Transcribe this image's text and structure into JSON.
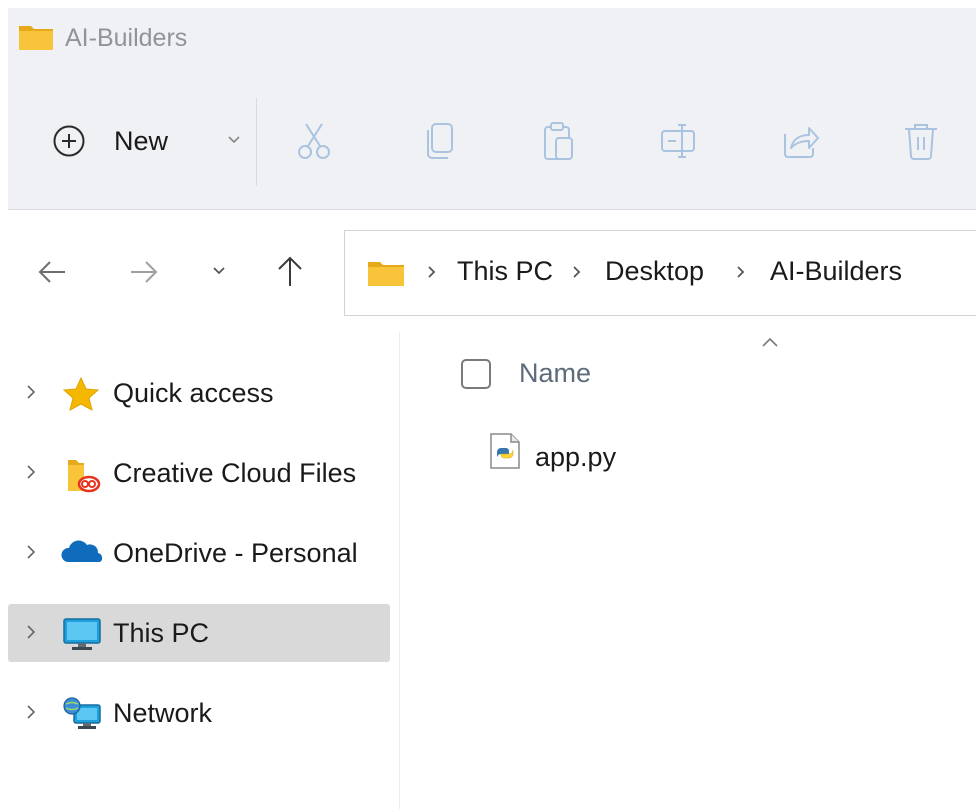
{
  "window": {
    "title": "AI-Builders"
  },
  "toolbar": {
    "new_label": "New",
    "icons": [
      "cut-icon",
      "copy-icon",
      "paste-icon",
      "rename-icon",
      "share-icon",
      "delete-icon"
    ]
  },
  "address": {
    "crumbs": [
      "This PC",
      "Desktop",
      "AI-Builders"
    ]
  },
  "nav": {
    "items": [
      {
        "label": "Quick access",
        "icon": "star-icon"
      },
      {
        "label": "Creative Cloud Files",
        "icon": "creative-cloud-folder-icon"
      },
      {
        "label": "OneDrive - Personal",
        "icon": "onedrive-cloud-icon"
      },
      {
        "label": "This PC",
        "icon": "monitor-icon",
        "selected": true
      },
      {
        "label": "Network",
        "icon": "network-icon"
      }
    ]
  },
  "content": {
    "column_header": "Name",
    "files": [
      {
        "name": "app.py",
        "icon": "python-file-icon"
      }
    ]
  },
  "colors": {
    "toolbar_bg": "#f0f1f5",
    "icon_disabled": "#a9c3e0",
    "folder_yellow": "#f8c53a",
    "selected_bg": "#d9d9d9",
    "star": "#f5b800",
    "onedrive": "#0f6cbd"
  }
}
